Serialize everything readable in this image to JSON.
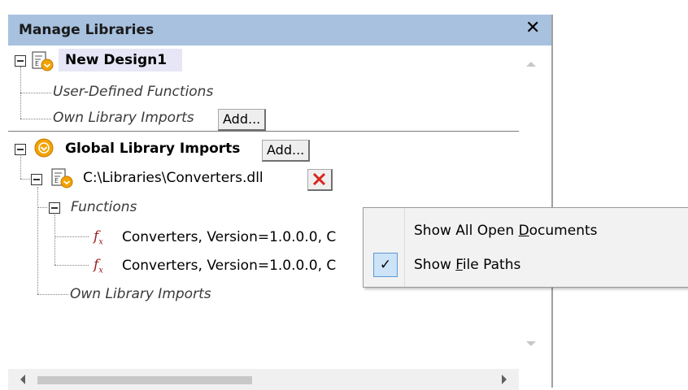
{
  "panel": {
    "title": "Manage Libraries",
    "close_glyph": "✕",
    "tree": {
      "design": {
        "name": "New Design1",
        "icon": "design-file-icon",
        "children": {
          "udf": "User-Defined Functions",
          "own_imports": "Own Library Imports",
          "own_imports_add": "Add..."
        }
      },
      "global": {
        "name": "Global Library Imports",
        "icon": "global-library-icon",
        "add": "Add...",
        "library": {
          "path": "C:\\Libraries\\Converters.dll",
          "remove_glyph": "✕",
          "functions_label": "Functions",
          "functions": [
            "Converters, Version=1.0.0.0, C",
            "Converters, Version=1.0.0.0, C"
          ],
          "own_imports": "Own Library Imports"
        }
      }
    }
  },
  "context_menu": {
    "items": [
      {
        "label_pre": "Show All Open ",
        "label_key": "D",
        "label_post": "ocuments",
        "checked": false
      },
      {
        "label_pre": "Show ",
        "label_key": "F",
        "label_post": "ile Paths",
        "checked": true
      }
    ],
    "check_glyph": "✓"
  },
  "colors": {
    "title_bar": "#a7c1df",
    "remove_icon": "#d9261c",
    "fx_icon": "#9a1d1d",
    "menu_check_bg": "#cde3f7"
  }
}
